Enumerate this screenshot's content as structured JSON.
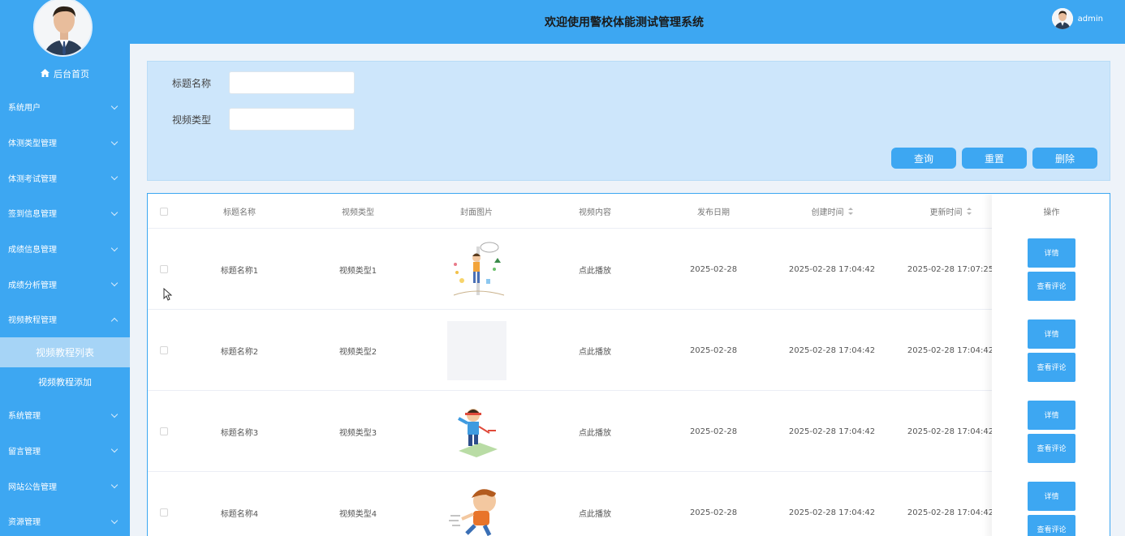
{
  "header": {
    "title": "欢迎使用警校体能测试管理系统",
    "username": "admin"
  },
  "sidebar": {
    "home_label": "后台首页",
    "items": [
      {
        "label": "系统用户"
      },
      {
        "label": "体测类型管理"
      },
      {
        "label": "体测考试管理"
      },
      {
        "label": "签到信息管理"
      },
      {
        "label": "成绩信息管理"
      },
      {
        "label": "成绩分析管理"
      },
      {
        "label": "视频教程管理"
      }
    ],
    "submenu": [
      {
        "label": "视频教程列表",
        "active": true
      },
      {
        "label": "视频教程添加",
        "active": false
      }
    ],
    "items_after": [
      {
        "label": "系统管理"
      },
      {
        "label": "留言管理"
      },
      {
        "label": "网站公告管理"
      },
      {
        "label": "资源管理"
      }
    ]
  },
  "search": {
    "title_label": "标题名称",
    "title_value": "",
    "type_label": "视频类型",
    "type_value": "",
    "query_button": "查询",
    "reset_button": "重置",
    "delete_button": "删除"
  },
  "table": {
    "headers": {
      "title": "标题名称",
      "type": "视频类型",
      "cover": "封面图片",
      "content": "视频内容",
      "publish_date": "发布日期",
      "created": "创建时间",
      "updated": "更新时间",
      "ops": "操作"
    },
    "rows": [
      {
        "title": "标题名称1",
        "type": "视频类型1",
        "content": "点此播放",
        "publish_date": "2025-02-28",
        "created": "2025-02-28 17:04:42",
        "updated": "2025-02-28 17:07:25",
        "cover": "illustration-measure",
        "detail": "详情",
        "comments": "查看评论"
      },
      {
        "title": "标题名称2",
        "type": "视频类型2",
        "content": "点此播放",
        "publish_date": "2025-02-28",
        "created": "2025-02-28 17:04:42",
        "updated": "2025-02-28 17:04:42",
        "cover": "blank",
        "detail": "详情",
        "comments": "查看评论"
      },
      {
        "title": "标题名称3",
        "type": "视频类型3",
        "content": "点此播放",
        "publish_date": "2025-02-28",
        "created": "2025-02-28 17:04:42",
        "updated": "2025-02-28 17:04:42",
        "cover": "illustration-runner",
        "detail": "详情",
        "comments": "查看评论"
      },
      {
        "title": "标题名称4",
        "type": "视频类型4",
        "content": "点此播放",
        "publish_date": "2025-02-28",
        "created": "2025-02-28 17:04:42",
        "updated": "2025-02-28 17:04:42",
        "cover": "illustration-boy",
        "detail": "详情",
        "comments": "查看评论"
      }
    ]
  },
  "colors": {
    "primary": "#3da7f2",
    "panel": "#cde6fb",
    "active_submenu": "#a6d4f6"
  }
}
